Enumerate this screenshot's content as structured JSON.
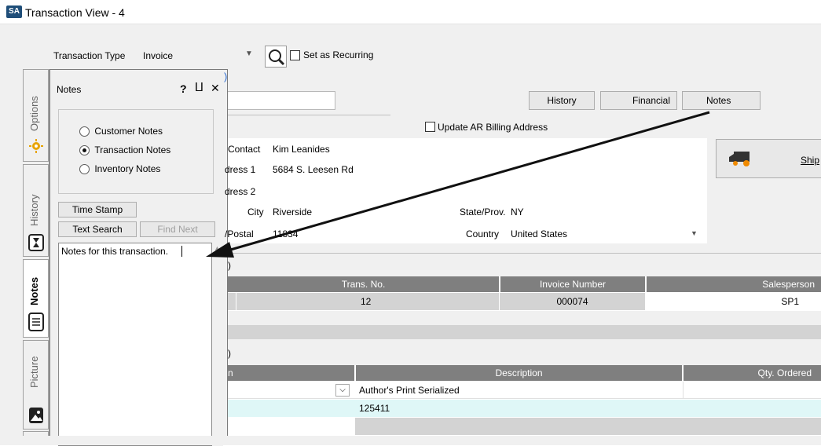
{
  "window": {
    "logo": "SA",
    "title": "Transaction View - 4"
  },
  "toolbar": {
    "transaction_type_label": "Transaction Type",
    "transaction_type_value": "Invoice",
    "recurring_label": "Set as Recurring"
  },
  "side_tabs": [
    {
      "label": "Options",
      "icon": "options-icon"
    },
    {
      "label": "History",
      "icon": "hourglass-icon"
    },
    {
      "label": "Notes",
      "icon": "notes-icon"
    },
    {
      "label": "Picture",
      "icon": "picture-icon"
    }
  ],
  "notes_panel": {
    "title": "Notes",
    "help": "?",
    "pin": "⨿",
    "close": "✕",
    "options": [
      "Customer Notes",
      "Transaction Notes",
      "Inventory Notes"
    ],
    "selected_option": "Transaction Notes",
    "time_stamp_label": "Time Stamp",
    "text_search_label": "Text Search",
    "find_next_label": "Find Next",
    "notes_text": "Notes for this transaction."
  },
  "header_buttons": {
    "history": "History",
    "financial": "Financial",
    "notes": "Notes"
  },
  "update_ar_label": "Update AR Billing Address",
  "address": {
    "contact_label": "Contact",
    "contact_value": "Kim Leanides",
    "address1_label": "dress 1",
    "address1_value": "5684 S. Leesen Rd",
    "address2_label": "dress 2",
    "address2_value": "",
    "city_label": "City",
    "city_value": "Riverside",
    "state_label": "State/Prov.",
    "state_value": "NY",
    "postal_label": "/Postal",
    "postal_value": "11834",
    "country_label": "Country",
    "country_value": "United States"
  },
  "ship_button": "Ship",
  "paren1": ")",
  "paren2": ")",
  "trans_table": {
    "headers": [
      "Trans. No.",
      "Invoice Number",
      "Salesperson"
    ],
    "row": [
      "12",
      "000074",
      "SP1"
    ]
  },
  "items_table": {
    "headers": [
      "n",
      "Description",
      "Qty. Ordered"
    ],
    "rows": [
      [
        "",
        "Author's Print Serialized",
        ""
      ],
      [
        "",
        "125411",
        ""
      ],
      [
        "",
        "",
        ""
      ]
    ]
  }
}
